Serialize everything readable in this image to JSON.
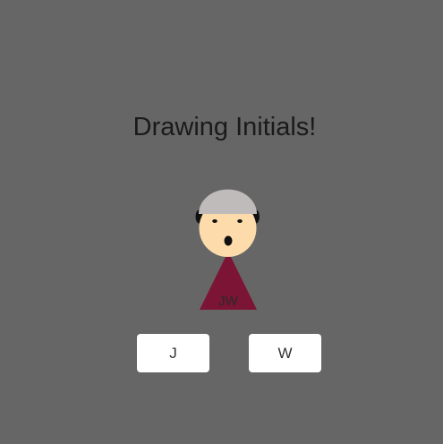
{
  "page": {
    "title": "Drawing Initials!"
  },
  "figure": {
    "initials": "JW",
    "colors": {
      "hair": "#bfbbbb",
      "ears": "#111111",
      "face": "#fedbaa",
      "eyes": "#111111",
      "mouth": "#111111",
      "body": "#7c1436",
      "initials_text": "#2a2a2a"
    }
  },
  "buttons": [
    {
      "label": "J"
    },
    {
      "label": "W"
    }
  ],
  "colors": {
    "background": "#666666",
    "button_bg": "#ffffff"
  }
}
